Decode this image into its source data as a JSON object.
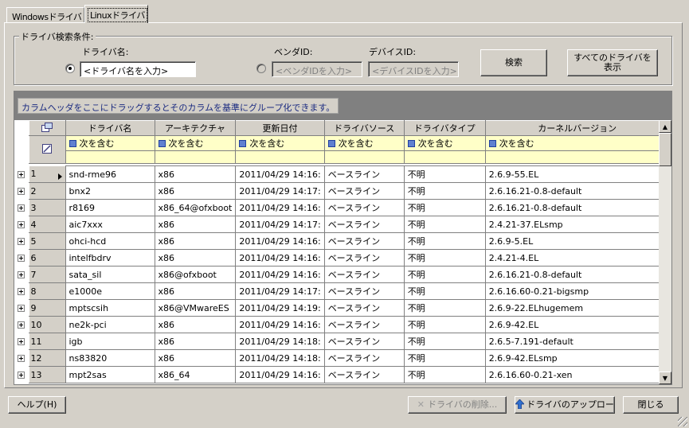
{
  "tabs": [
    {
      "label": "Windowsドライバ",
      "active": false
    },
    {
      "label": "Linuxドライバ",
      "active": true
    }
  ],
  "search": {
    "group_title": "ドライバ検索条件:",
    "driver_name_label": "ドライバ名:",
    "driver_name_placeholder": "<ドライバ名を入力>",
    "vendor_id_label": "ベンダID:",
    "vendor_id_placeholder": "<ベンダIDを入力>",
    "device_id_label": "デバイスID:",
    "device_id_placeholder": "<デバイスIDを入力>",
    "search_button": "検索",
    "show_all_button_line1": "すべてのドライバを",
    "show_all_button_line2": "表示"
  },
  "grid": {
    "group_by_hint": "カラムヘッダをここにドラッグするとそのカラムを基準にグループ化できます。",
    "columns": [
      "ドライバ名",
      "アーキテクチャ",
      "更新日付",
      "ドライバソース",
      "ドライバタイプ",
      "カーネルバージョン"
    ],
    "filter_label": "次を含む",
    "rows": [
      {
        "no": "1",
        "name": "snd-rme96",
        "arch": "x86",
        "date": "2011/04/29 14:16:",
        "source": "ベースライン",
        "type": "不明",
        "kernel": "2.6.9-55.EL"
      },
      {
        "no": "2",
        "name": "bnx2",
        "arch": "x86",
        "date": "2011/04/29 14:17:",
        "source": "ベースライン",
        "type": "不明",
        "kernel": "2.6.16.21-0.8-default"
      },
      {
        "no": "3",
        "name": "r8169",
        "arch": "x86_64@ofxboot",
        "date": "2011/04/29 14:16:",
        "source": "ベースライン",
        "type": "不明",
        "kernel": "2.6.16.21-0.8-default"
      },
      {
        "no": "4",
        "name": "aic7xxx",
        "arch": "x86",
        "date": "2011/04/29 14:17:",
        "source": "ベースライン",
        "type": "不明",
        "kernel": "2.4.21-37.ELsmp"
      },
      {
        "no": "5",
        "name": "ohci-hcd",
        "arch": "x86",
        "date": "2011/04/29 14:16:",
        "source": "ベースライン",
        "type": "不明",
        "kernel": "2.6.9-5.EL"
      },
      {
        "no": "6",
        "name": "intelfbdrv",
        "arch": "x86",
        "date": "2011/04/29 14:16:",
        "source": "ベースライン",
        "type": "不明",
        "kernel": "2.4.21-4.EL"
      },
      {
        "no": "7",
        "name": "sata_sil",
        "arch": "x86@ofxboot",
        "date": "2011/04/29 14:16:",
        "source": "ベースライン",
        "type": "不明",
        "kernel": "2.6.16.21-0.8-default"
      },
      {
        "no": "8",
        "name": "e1000e",
        "arch": "x86",
        "date": "2011/04/29 14:17:",
        "source": "ベースライン",
        "type": "不明",
        "kernel": "2.6.16.60-0.21-bigsmp"
      },
      {
        "no": "9",
        "name": "mptscsih",
        "arch": "x86@VMwareES",
        "date": "2011/04/29 14:19:",
        "source": "ベースライン",
        "type": "不明",
        "kernel": "2.6.9-22.ELhugemem"
      },
      {
        "no": "10",
        "name": "ne2k-pci",
        "arch": "x86",
        "date": "2011/04/29 14:16:",
        "source": "ベースライン",
        "type": "不明",
        "kernel": "2.6.9-42.EL"
      },
      {
        "no": "11",
        "name": "igb",
        "arch": "x86",
        "date": "2011/04/29 14:18:",
        "source": "ベースライン",
        "type": "不明",
        "kernel": "2.6.5-7.191-default"
      },
      {
        "no": "12",
        "name": "ns83820",
        "arch": "x86",
        "date": "2011/04/29 14:18:",
        "source": "ベースライン",
        "type": "不明",
        "kernel": "2.6.9-42.ELsmp"
      },
      {
        "no": "13",
        "name": "mpt2sas",
        "arch": "x86_64",
        "date": "2011/04/29 14:16:",
        "source": "ベースライン",
        "type": "不明",
        "kernel": "2.6.16.60-0.21-xen"
      }
    ]
  },
  "footer": {
    "help_button": "ヘルプ(H)",
    "delete_button": "ドライバの削除...",
    "upload_button": "ドライバのアップロー",
    "close_button": "閉じる"
  }
}
